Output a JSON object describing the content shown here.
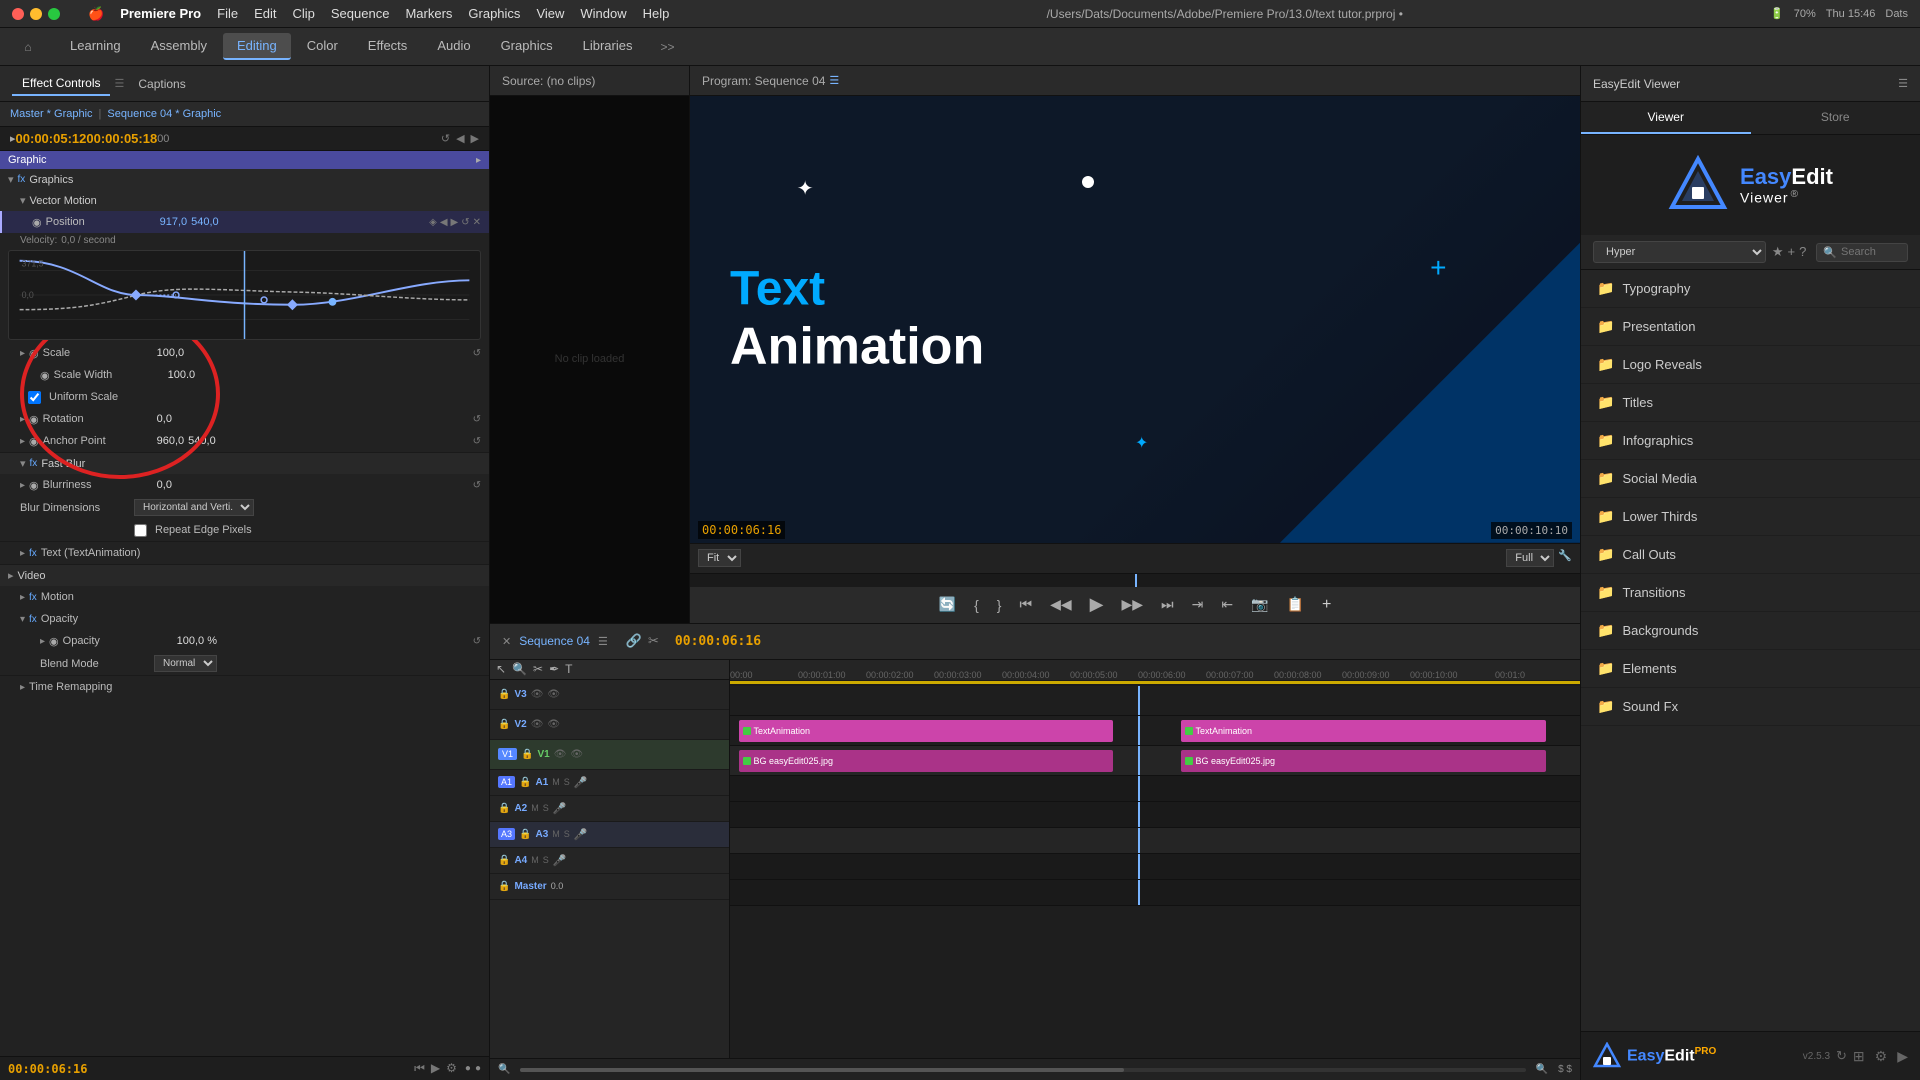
{
  "window": {
    "title": "/Users/Dats/Documents/Adobe/Premiere Pro/13.0/text tutor.prproj •",
    "app_name": "Premiere Pro"
  },
  "mac_menu": {
    "items": [
      "File",
      "Edit",
      "Clip",
      "Sequence",
      "Markers",
      "Graphics",
      "View",
      "Window",
      "Help"
    ]
  },
  "mac_system": {
    "time": "Thu 15:46",
    "battery": "70%",
    "user": "Dats"
  },
  "top_nav": {
    "home_icon": "⌂",
    "items": [
      {
        "label": "Learning",
        "active": false
      },
      {
        "label": "Assembly",
        "active": false
      },
      {
        "label": "Editing",
        "active": true,
        "dot": true
      },
      {
        "label": "Color",
        "active": false
      },
      {
        "label": "Effects",
        "active": false
      },
      {
        "label": "Audio",
        "active": false
      },
      {
        "label": "Graphics",
        "active": false
      },
      {
        "label": "Libraries",
        "active": false
      }
    ],
    "more_icon": ">>"
  },
  "left_panel": {
    "tabs": [
      {
        "label": "Effect Controls",
        "active": true
      },
      {
        "label": "Captions",
        "active": false
      }
    ],
    "master_label": "Master * Graphic",
    "sequence_label": "Sequence 04 * Graphic",
    "timecodes": {
      "in": "00:00:05:12",
      "out": "00:00:05:18",
      "end": "00"
    },
    "current_time": "00:00:06:16",
    "graphic_label": "Graphic",
    "sections": {
      "graphics": {
        "label": "Graphics",
        "vector_motion": {
          "label": "Vector Motion",
          "position": {
            "label": "Position",
            "x": "917,0",
            "y": "540,0",
            "velocity_label": "Velocity:",
            "velocity": "0,0 / second"
          },
          "scale": {
            "label": "Scale",
            "value": "100,0"
          },
          "scale_width": {
            "label": "Scale Width",
            "value": "100.0"
          },
          "rotation": {
            "label": "Rotation",
            "value": "0,0"
          },
          "anchor_point": {
            "label": "Anchor Point",
            "x": "960,0",
            "y": "540,0"
          }
        },
        "fast_blur": {
          "label": "Fast Blur",
          "blurriness": {
            "label": "Blurriness",
            "value": "0,0"
          },
          "blur_dimensions": {
            "label": "Blur Dimensions",
            "value": "Horizontal and Verti..."
          },
          "repeat_edge_pixels": {
            "label": "Repeat Edge Pixels",
            "checked": false
          }
        },
        "text_layer": {
          "label": "Text (TextAnimation)"
        }
      },
      "video": {
        "label": "Video",
        "motion": {
          "label": "Motion"
        },
        "opacity": {
          "label": "Opacity",
          "value": "100,0 %",
          "blend_mode": "Normal"
        }
      },
      "time_remapping": {
        "label": "Time Remapping"
      }
    }
  },
  "program_monitor": {
    "source_label": "Source: (no clips)",
    "program_label": "Program: Sequence 04",
    "fit_label": "Fit",
    "resolution_label": "Full",
    "timecode_current": "00:00:06:16",
    "timecode_total": "00:00:10:10",
    "animation": {
      "line1": "Text",
      "line2": "Animation"
    },
    "controls": {
      "prev_keyframe": "⏮",
      "step_back": "⏪",
      "play": "▶",
      "step_fwd": "⏩",
      "next_keyframe": "⏭"
    }
  },
  "timeline": {
    "sequence_label": "Sequence 04",
    "current_time": "00:00:06:16",
    "tracks": {
      "video": [
        {
          "label": "V3",
          "type": "video"
        },
        {
          "label": "V2",
          "type": "video"
        },
        {
          "label": "V1",
          "type": "video",
          "active": true
        }
      ],
      "audio": [
        {
          "label": "A1",
          "type": "audio"
        },
        {
          "label": "A2",
          "type": "audio"
        },
        {
          "label": "A3",
          "type": "audio"
        },
        {
          "label": "A4",
          "type": "audio"
        },
        {
          "label": "Master",
          "type": "audio"
        }
      ]
    },
    "clips": {
      "text_animation_1": {
        "name": "TextAnimation",
        "start": 0,
        "duration": "~50%"
      },
      "bg_1": {
        "name": "BG easyEdit025.jpg",
        "start": 0,
        "duration": "~50%"
      },
      "text_animation_2": {
        "name": "TextAnimation",
        "start": "~54%",
        "duration": "~46%"
      },
      "bg_2": {
        "name": "BG easyEdit025.jpg",
        "start": "~54%",
        "duration": "~46%"
      }
    },
    "time_marks": [
      "00:00",
      "00:00:01:00",
      "00:00:02:00",
      "00:00:03:00",
      "00:00:04:00",
      "00:00:05:00",
      "00:00:06:00",
      "00:00:07:00",
      "00:00:08:00",
      "00:00:09:00",
      "00:00:10:00",
      "00:01:0"
    ]
  },
  "easyedit": {
    "header_label": "EasyEdit Viewer",
    "tabs": [
      "Viewer",
      "Store"
    ],
    "active_tab": "Viewer",
    "preset_selected": "Hyper",
    "search_placeholder": "Search",
    "categories": [
      {
        "label": "Typography"
      },
      {
        "label": "Presentation"
      },
      {
        "label": "Logo Reveals"
      },
      {
        "label": "Titles"
      },
      {
        "label": "Infographics"
      },
      {
        "label": "Social Media"
      },
      {
        "label": "Lower Thirds"
      },
      {
        "label": "Call Outs"
      },
      {
        "label": "Transitions"
      },
      {
        "label": "Backgrounds"
      },
      {
        "label": "Elements"
      },
      {
        "label": "Sound Fx"
      }
    ],
    "bottom_logo": "EasyEdit",
    "version": "v2.5.3"
  },
  "icons": {
    "folder": "📁",
    "star": "★",
    "plus": "+",
    "question": "?",
    "lock": "🔒",
    "eye": "👁",
    "chevron_down": "▾",
    "chevron_right": "▸",
    "play": "▶",
    "stop": "■",
    "pencil": "✏"
  }
}
